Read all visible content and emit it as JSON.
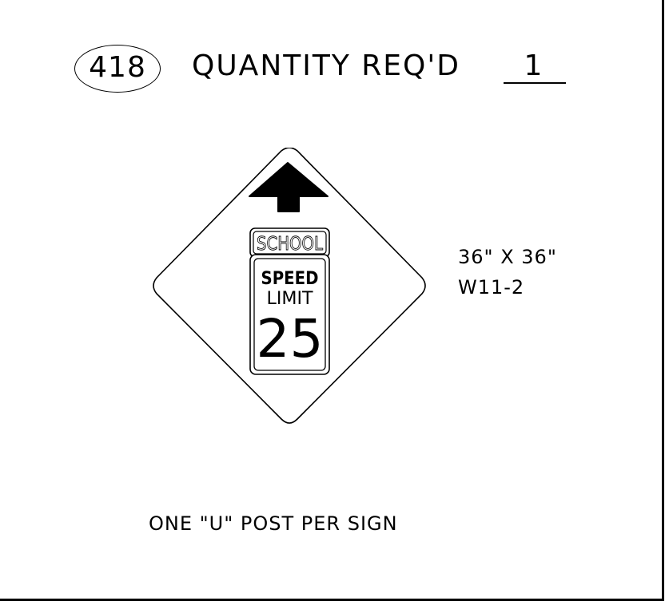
{
  "sheet": {
    "sign_number": "418",
    "quantity_label": "QUANTITY REQ'D",
    "quantity_value": "1"
  },
  "sign": {
    "panel_top": "SCHOOL",
    "line1": "SPEED",
    "line2": "LIMIT",
    "speed": "25",
    "arrow": "arrow-up-icon",
    "colors": {
      "stroke": "#000000",
      "fill": "#ffffff"
    }
  },
  "specs": {
    "size": "36\" X 36\"",
    "code": "W11-2"
  },
  "note": "ONE \"U\" POST PER SIGN"
}
